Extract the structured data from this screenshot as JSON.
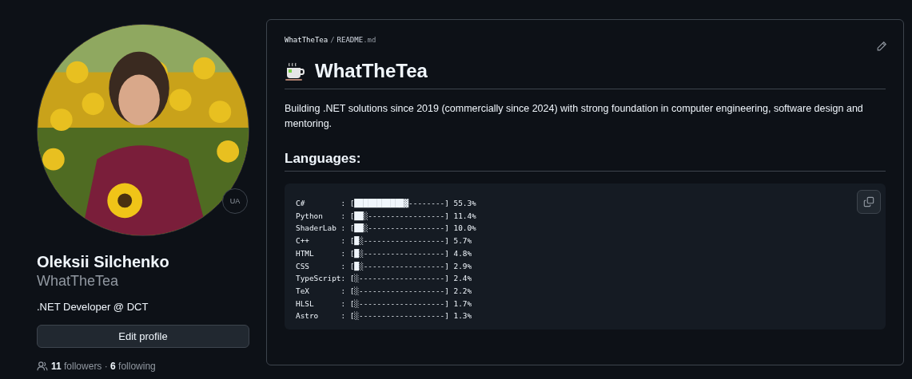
{
  "profile": {
    "badge": "UA",
    "name": "Oleksii Silchenko",
    "username": "WhatTheTea",
    "bio": ".NET Developer @ DCT",
    "edit_button": "Edit profile",
    "follow_info": "**11** followers · **6** following"
  },
  "readme": {
    "breadcrumb_repo": "WhatTheTea",
    "breadcrumb_sep": "/",
    "breadcrumb_file": "README",
    "breadcrumb_ext": ".md",
    "title": "WhatTheTea",
    "description": "Building .NET solutions since 2019 (commercially since 2024) with strong foundation in computer engineering, software design and mentoring.",
    "section_heading": "Languages:",
    "code_lines": [
      "C#        : [███████████▓--------] 55.3%",
      "Python    : [██░-----------------] 11.4%",
      "ShaderLab : [██░-----------------] 10.0%",
      "C++       : [█░------------------] 5.7%",
      "HTML      : [█░------------------] 4.8%",
      "CSS       : [█░------------------] 2.9%",
      "TypeScript: [░-------------------] 2.4%",
      "TeX       : [░-------------------] 2.2%",
      "HLSL      : [░-------------------] 1.7%",
      "Astro     : [░-------------------] 1.3%"
    ]
  }
}
